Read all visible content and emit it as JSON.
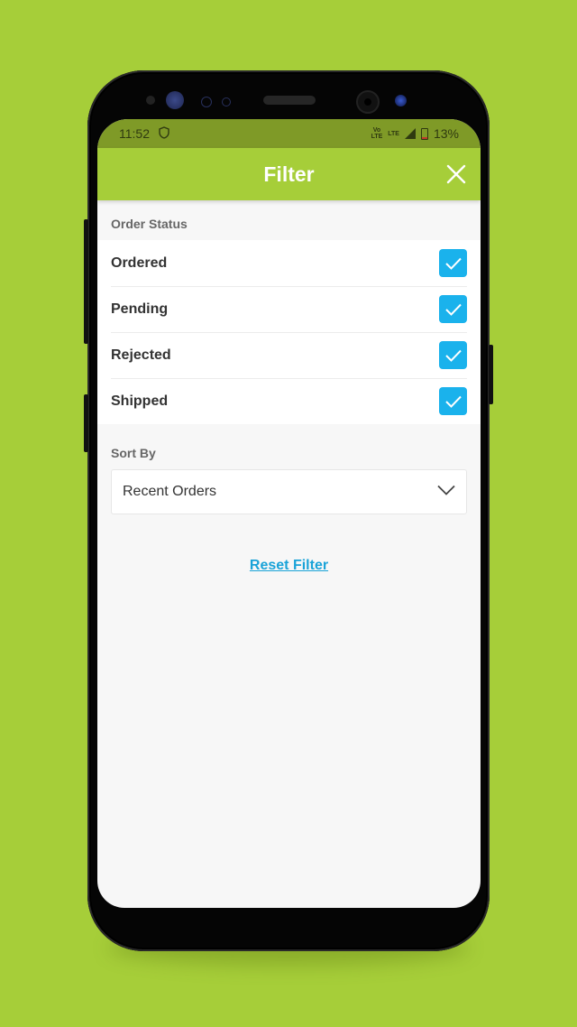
{
  "statusbar": {
    "time": "11:52",
    "volte_label": "Vo LTE",
    "lte_label": "LTE",
    "battery": "13%"
  },
  "header": {
    "title": "Filter",
    "close_icon": "close-icon"
  },
  "order_status": {
    "label": "Order Status",
    "items": [
      {
        "label": "Ordered",
        "checked": true
      },
      {
        "label": "Pending",
        "checked": true
      },
      {
        "label": "Rejected",
        "checked": true
      },
      {
        "label": "Shipped",
        "checked": true
      }
    ]
  },
  "sort_by": {
    "label": "Sort By",
    "selected": "Recent Orders"
  },
  "reset_label": "Reset Filter",
  "colors": {
    "brand": "#a6ce39",
    "status_bar": "#7f9a27",
    "checkbox": "#1ab2ec",
    "link": "#1aa3d8"
  }
}
